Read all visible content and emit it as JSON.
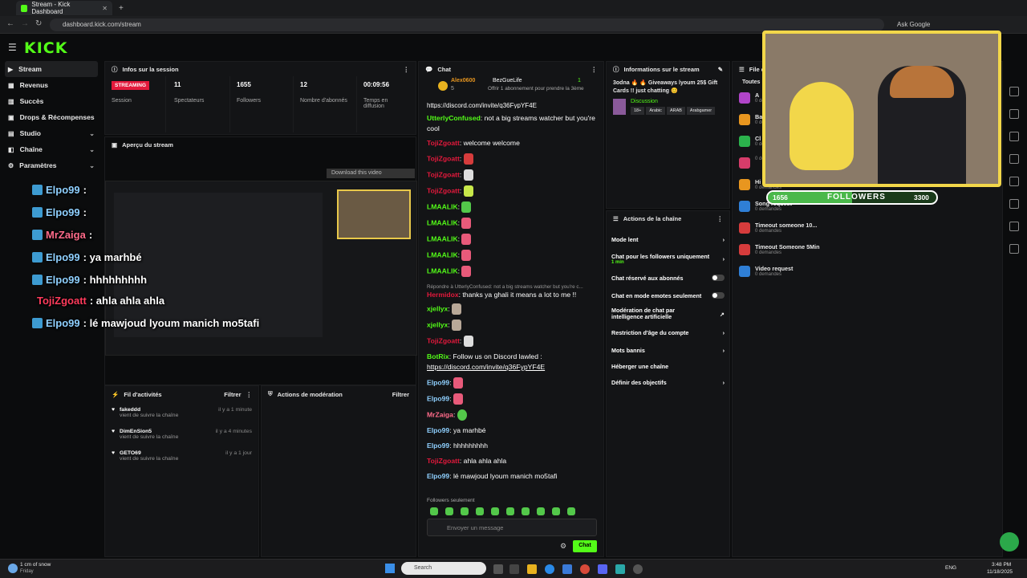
{
  "browser": {
    "tab_title": "Stream - Kick Dashboard",
    "url": "dashboard.kick.com/stream",
    "ask_google": "Ask Google"
  },
  "logo": "KICK",
  "sidebar": {
    "items": [
      {
        "label": "Stream",
        "icon": "stream-icon"
      },
      {
        "label": "Revenus",
        "icon": "revenue-icon"
      },
      {
        "label": "Succès",
        "icon": "trophy-icon"
      },
      {
        "label": "Drops & Récompenses",
        "icon": "gift-icon"
      },
      {
        "label": "Studio",
        "icon": "studio-icon"
      },
      {
        "label": "Chaîne",
        "icon": "channel-icon"
      },
      {
        "label": "Paramètres",
        "icon": "gear-icon"
      }
    ]
  },
  "session": {
    "title": "Infos sur la session",
    "badge": "STREAMING",
    "badge_label": "Session",
    "stats": [
      {
        "value": "11",
        "label": "Spectateurs"
      },
      {
        "value": "1655",
        "label": "Followers"
      },
      {
        "value": "12",
        "label": "Nombre d'abonnés"
      },
      {
        "value": "00:09:56",
        "label": "Temps en diffusion"
      }
    ]
  },
  "preview": {
    "title": "Aperçu du stream",
    "download": "Download this video"
  },
  "overlay_chat": [
    {
      "user": "Elpo99",
      "text": ":",
      "color": "#8fd0ff"
    },
    {
      "user": "Elpo99",
      "text": ":",
      "color": "#8fd0ff"
    },
    {
      "user": "MrZaiga",
      "text": ":",
      "color": "#ff6b8a"
    },
    {
      "user": "Elpo99",
      "text": ": ya marhbé",
      "color": "#8fd0ff"
    },
    {
      "user": "Elpo99",
      "text": ": hhhhhhhhh",
      "color": "#8fd0ff"
    },
    {
      "user": "TojiZgoatt",
      "text": ": ahla ahla ahla",
      "color": "#ff3b5c"
    },
    {
      "user": "Elpo99",
      "text": ": lé mawjoud lyoum manich mo5tafi",
      "color": "#8fd0ff"
    }
  ],
  "activity": {
    "title": "Fil d'activités",
    "filter": "Filtrer",
    "items": [
      {
        "user": "fakeddd",
        "action": "vient de suivre la chaîne",
        "time": "il y a 1 minute"
      },
      {
        "user": "DimEnSion5",
        "action": "vient de suivre la chaîne",
        "time": "il y a 4 minutes"
      },
      {
        "user": "GETO69",
        "action": "vient de suivre la chaîne",
        "time": "il y a 1 jour"
      }
    ]
  },
  "moderation": {
    "title": "Actions de modération",
    "filter": "Filtrer"
  },
  "chat": {
    "title": "Chat",
    "pinned_user": "Alex0600",
    "pinned_sub": "5",
    "pinned_other": "BezGueLife",
    "pinned_count": "1",
    "pinned_note": "Offrir 1 abonnement pour prendre la 3ème",
    "partial_link": "https://discord.com/invite/q36FypYF4E",
    "messages": [
      {
        "user": "UtterlyConfused",
        "color": "#53fc18",
        "text": ": not a big streams watcher but you're cool"
      },
      {
        "user": "TojiZgoatt",
        "color": "#e3193c",
        "text": ": welcome welcome"
      },
      {
        "user": "TojiZgoatt",
        "color": "#e3193c",
        "text": ":"
      },
      {
        "user": "TojiZgoatt",
        "color": "#e3193c",
        "text": ":"
      },
      {
        "user": "TojiZgoatt",
        "color": "#e3193c",
        "text": ":"
      },
      {
        "user": "LMAALIK",
        "color": "#53fc18",
        "text": ":"
      },
      {
        "user": "LMAALIK",
        "color": "#53fc18",
        "text": ":"
      },
      {
        "user": "LMAALIK",
        "color": "#53fc18",
        "text": ":"
      },
      {
        "user": "LMAALIK",
        "color": "#53fc18",
        "text": ":"
      },
      {
        "user": "LMAALIK",
        "color": "#53fc18",
        "text": ":"
      }
    ],
    "reply_hint": "Répondre à UtterlyConfused: not a big streams watcher but you're c...",
    "messages2": [
      {
        "user": "Hermidox",
        "color": "#e3193c",
        "text": ": thanks ya ghali it means a lot to me !!"
      },
      {
        "user": "xjellyx",
        "color": "#53fc18",
        "text": ":"
      },
      {
        "user": "xjellyx",
        "color": "#53fc18",
        "text": ":"
      },
      {
        "user": "TojiZgoatt",
        "color": "#e3193c",
        "text": ":"
      },
      {
        "user": "BotRix",
        "color": "#53fc18",
        "text": ": Follow us on Discord lawled :"
      },
      {
        "user": "",
        "color": "#fff",
        "text": "https://discord.com/invite/q36FypYF4E"
      },
      {
        "user": "Elpo99",
        "color": "#8fd0ff",
        "text": ":"
      },
      {
        "user": "Elpo99",
        "color": "#8fd0ff",
        "text": ":"
      },
      {
        "user": "MrZaiga",
        "color": "#ff6b8a",
        "text": ":"
      },
      {
        "user": "Elpo99",
        "color": "#8fd0ff",
        "text": ": ya marhbé"
      },
      {
        "user": "Elpo99",
        "color": "#8fd0ff",
        "text": ": hhhhhhhhh"
      },
      {
        "user": "TojiZgoatt",
        "color": "#e3193c",
        "text": ": ahla ahla ahla"
      },
      {
        "user": "Elpo99",
        "color": "#8fd0ff",
        "text": ": lé mawjoud lyoum manich mo5tafi"
      }
    ],
    "followers_only": "Followers seulement",
    "input_placeholder": "Envoyer un message",
    "send": "Chat"
  },
  "stream_info": {
    "title": "Informations sur le stream",
    "stream_title": "3odna 🔥 🔥 Giveaways lyoum 25$ Gift Cards !! just chatting 😊",
    "category": "Discussion",
    "tags": [
      "18+",
      "Arabic",
      "ARAB",
      "Arabgamer"
    ]
  },
  "channel_actions": {
    "title": "Actions de la chaîne",
    "items": [
      {
        "label": "Mode lent",
        "type": "chevron"
      },
      {
        "label": "Chat pour les followers uniquement",
        "sub": "1 min",
        "type": "chevron"
      },
      {
        "label": "Chat réservé aux abonnés",
        "type": "toggle"
      },
      {
        "label": "Chat en mode emotes seulement",
        "type": "toggle"
      },
      {
        "label": "Modération de chat par intelligence artificielle",
        "type": "link"
      },
      {
        "label": "Restriction d'âge du compte",
        "type": "chevron"
      },
      {
        "label": "Mots bannis",
        "type": "chevron"
      },
      {
        "label": "Héberger une chaîne",
        "type": "none"
      },
      {
        "label": "Définir des objectifs",
        "type": "chevron"
      }
    ]
  },
  "queue": {
    "title": "File d",
    "filter_all": "Toutes",
    "items": [
      {
        "label": "A",
        "sub": "0 demandes",
        "color": "#b044c8"
      },
      {
        "label": "Ba",
        "sub": "0 demandes",
        "color": "#e8961f"
      },
      {
        "label": "Cl",
        "sub": "0 demandes",
        "color": "#2bb24c"
      },
      {
        "label": "",
        "sub": "0 demandes",
        "color": "#d63c6a"
      },
      {
        "label": "Hi",
        "sub": "0 demandes",
        "color": "#e8961f"
      },
      {
        "label": "Song request",
        "sub": "0 demandes",
        "color": "#2f7fd6"
      },
      {
        "label": "Timeout someone 10...",
        "sub": "0 demandes",
        "color": "#d63c3c"
      },
      {
        "label": "Timeout Someone 5Min",
        "sub": "0 demandes",
        "color": "#d63c3c"
      },
      {
        "label": "Video request",
        "sub": "0 demandes",
        "color": "#2f7fd6"
      }
    ]
  },
  "followers_goal": {
    "current": "1656",
    "label": "FOLLOWERS",
    "target": "3300",
    "progress": 0.502
  },
  "taskbar": {
    "weather": "1 cm of snow",
    "weather_sub": "Friday",
    "search": "Search",
    "lang": "ENG",
    "time": "3:48 PM",
    "date": "11/18/2025"
  }
}
